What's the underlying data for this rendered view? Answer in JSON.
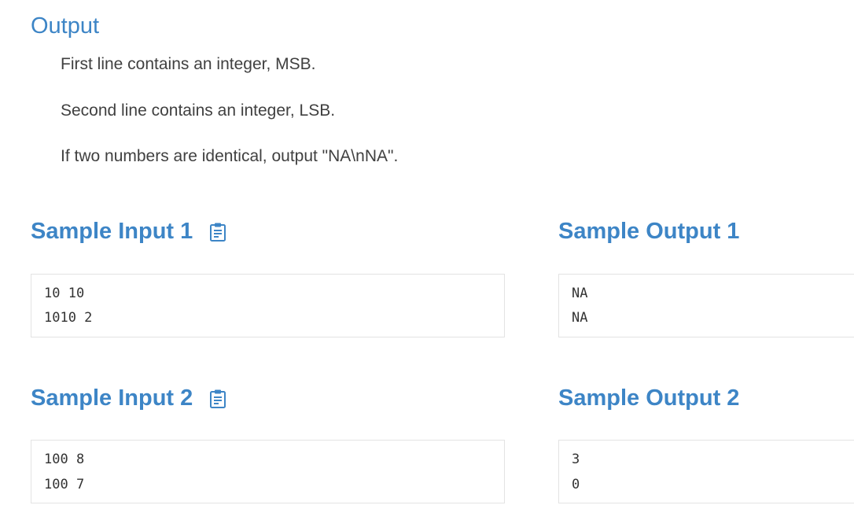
{
  "output_section": {
    "title": "Output",
    "paragraphs": [
      "First line contains an integer, MSB.",
      "Second line contains an integer, LSB.",
      "If two numbers are identical, output \"NA\\nNA\"."
    ]
  },
  "samples": [
    {
      "input_title": "Sample Input 1",
      "input_lines": [
        "10 10",
        "1010 2"
      ],
      "output_title": "Sample Output 1",
      "output_lines": [
        "NA",
        "NA"
      ]
    },
    {
      "input_title": "Sample Input 2",
      "input_lines": [
        "100 8",
        "100 7"
      ],
      "output_title": "Sample Output 2",
      "output_lines": [
        "3",
        "0"
      ]
    }
  ],
  "icons": {
    "copy": "clipboard-icon"
  },
  "colors": {
    "accent": "#3d85c6",
    "text": "#404040",
    "border": "#e3e3e3"
  }
}
